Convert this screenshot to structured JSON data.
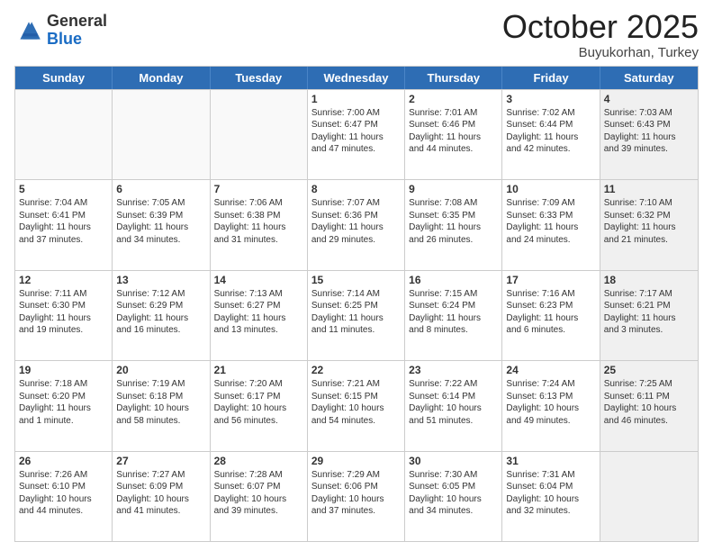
{
  "logo": {
    "general": "General",
    "blue": "Blue"
  },
  "header": {
    "month": "October 2025",
    "location": "Buyukorhan, Turkey"
  },
  "weekdays": [
    "Sunday",
    "Monday",
    "Tuesday",
    "Wednesday",
    "Thursday",
    "Friday",
    "Saturday"
  ],
  "rows": [
    [
      {
        "day": "",
        "info": "",
        "empty": true
      },
      {
        "day": "",
        "info": "",
        "empty": true
      },
      {
        "day": "",
        "info": "",
        "empty": true
      },
      {
        "day": "1",
        "info": "Sunrise: 7:00 AM\nSunset: 6:47 PM\nDaylight: 11 hours\nand 47 minutes."
      },
      {
        "day": "2",
        "info": "Sunrise: 7:01 AM\nSunset: 6:46 PM\nDaylight: 11 hours\nand 44 minutes."
      },
      {
        "day": "3",
        "info": "Sunrise: 7:02 AM\nSunset: 6:44 PM\nDaylight: 11 hours\nand 42 minutes."
      },
      {
        "day": "4",
        "info": "Sunrise: 7:03 AM\nSunset: 6:43 PM\nDaylight: 11 hours\nand 39 minutes.",
        "shaded": true
      }
    ],
    [
      {
        "day": "5",
        "info": "Sunrise: 7:04 AM\nSunset: 6:41 PM\nDaylight: 11 hours\nand 37 minutes."
      },
      {
        "day": "6",
        "info": "Sunrise: 7:05 AM\nSunset: 6:39 PM\nDaylight: 11 hours\nand 34 minutes."
      },
      {
        "day": "7",
        "info": "Sunrise: 7:06 AM\nSunset: 6:38 PM\nDaylight: 11 hours\nand 31 minutes."
      },
      {
        "day": "8",
        "info": "Sunrise: 7:07 AM\nSunset: 6:36 PM\nDaylight: 11 hours\nand 29 minutes."
      },
      {
        "day": "9",
        "info": "Sunrise: 7:08 AM\nSunset: 6:35 PM\nDaylight: 11 hours\nand 26 minutes."
      },
      {
        "day": "10",
        "info": "Sunrise: 7:09 AM\nSunset: 6:33 PM\nDaylight: 11 hours\nand 24 minutes."
      },
      {
        "day": "11",
        "info": "Sunrise: 7:10 AM\nSunset: 6:32 PM\nDaylight: 11 hours\nand 21 minutes.",
        "shaded": true
      }
    ],
    [
      {
        "day": "12",
        "info": "Sunrise: 7:11 AM\nSunset: 6:30 PM\nDaylight: 11 hours\nand 19 minutes."
      },
      {
        "day": "13",
        "info": "Sunrise: 7:12 AM\nSunset: 6:29 PM\nDaylight: 11 hours\nand 16 minutes."
      },
      {
        "day": "14",
        "info": "Sunrise: 7:13 AM\nSunset: 6:27 PM\nDaylight: 11 hours\nand 13 minutes."
      },
      {
        "day": "15",
        "info": "Sunrise: 7:14 AM\nSunset: 6:25 PM\nDaylight: 11 hours\nand 11 minutes."
      },
      {
        "day": "16",
        "info": "Sunrise: 7:15 AM\nSunset: 6:24 PM\nDaylight: 11 hours\nand 8 minutes."
      },
      {
        "day": "17",
        "info": "Sunrise: 7:16 AM\nSunset: 6:23 PM\nDaylight: 11 hours\nand 6 minutes."
      },
      {
        "day": "18",
        "info": "Sunrise: 7:17 AM\nSunset: 6:21 PM\nDaylight: 11 hours\nand 3 minutes.",
        "shaded": true
      }
    ],
    [
      {
        "day": "19",
        "info": "Sunrise: 7:18 AM\nSunset: 6:20 PM\nDaylight: 11 hours\nand 1 minute."
      },
      {
        "day": "20",
        "info": "Sunrise: 7:19 AM\nSunset: 6:18 PM\nDaylight: 10 hours\nand 58 minutes."
      },
      {
        "day": "21",
        "info": "Sunrise: 7:20 AM\nSunset: 6:17 PM\nDaylight: 10 hours\nand 56 minutes."
      },
      {
        "day": "22",
        "info": "Sunrise: 7:21 AM\nSunset: 6:15 PM\nDaylight: 10 hours\nand 54 minutes."
      },
      {
        "day": "23",
        "info": "Sunrise: 7:22 AM\nSunset: 6:14 PM\nDaylight: 10 hours\nand 51 minutes."
      },
      {
        "day": "24",
        "info": "Sunrise: 7:24 AM\nSunset: 6:13 PM\nDaylight: 10 hours\nand 49 minutes."
      },
      {
        "day": "25",
        "info": "Sunrise: 7:25 AM\nSunset: 6:11 PM\nDaylight: 10 hours\nand 46 minutes.",
        "shaded": true
      }
    ],
    [
      {
        "day": "26",
        "info": "Sunrise: 7:26 AM\nSunset: 6:10 PM\nDaylight: 10 hours\nand 44 minutes."
      },
      {
        "day": "27",
        "info": "Sunrise: 7:27 AM\nSunset: 6:09 PM\nDaylight: 10 hours\nand 41 minutes."
      },
      {
        "day": "28",
        "info": "Sunrise: 7:28 AM\nSunset: 6:07 PM\nDaylight: 10 hours\nand 39 minutes."
      },
      {
        "day": "29",
        "info": "Sunrise: 7:29 AM\nSunset: 6:06 PM\nDaylight: 10 hours\nand 37 minutes."
      },
      {
        "day": "30",
        "info": "Sunrise: 7:30 AM\nSunset: 6:05 PM\nDaylight: 10 hours\nand 34 minutes."
      },
      {
        "day": "31",
        "info": "Sunrise: 7:31 AM\nSunset: 6:04 PM\nDaylight: 10 hours\nand 32 minutes."
      },
      {
        "day": "",
        "info": "",
        "empty": true,
        "shaded": true
      }
    ]
  ]
}
